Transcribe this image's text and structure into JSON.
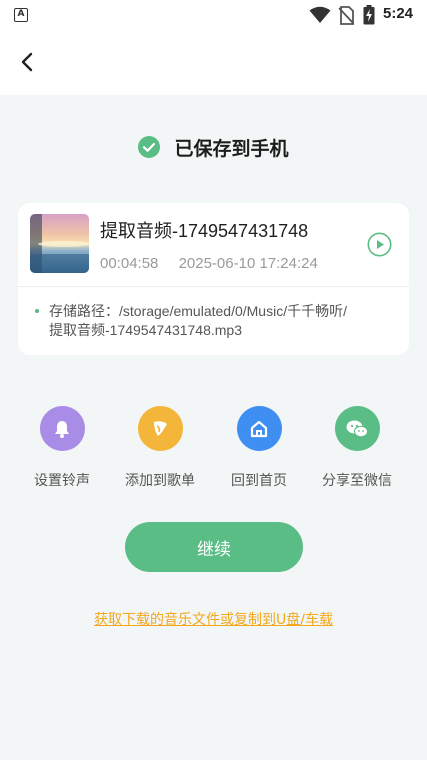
{
  "status_bar": {
    "app_icon_letter": "A",
    "time": "5:24"
  },
  "header": {
    "saved_title": "已保存到手机"
  },
  "file_card": {
    "name": "提取音频-1749547431748",
    "duration": "00:04:58",
    "datetime": "2025-06-10 17:24:24",
    "path_line1": "存储路径：/storage/emulated/0/Music/千千畅听/",
    "path_line2": "提取音频-1749547431748.mp3"
  },
  "actions": [
    {
      "label": "设置铃声",
      "icon": "bell-icon",
      "color": "#a98ce6"
    },
    {
      "label": "添加到歌单",
      "icon": "music-add-icon",
      "color": "#f4b63a"
    },
    {
      "label": "回到首页",
      "icon": "home-icon",
      "color": "#3f8ff3"
    },
    {
      "label": "分享至微信",
      "icon": "wechat-icon",
      "color": "#5bbd86"
    }
  ],
  "continue_label": "继续",
  "help_link": "获取下载的音乐文件或复制到U盘/车载",
  "colors": {
    "accent": "#5bbd86",
    "link": "#f2a81d",
    "background": "#f3f6f6"
  }
}
